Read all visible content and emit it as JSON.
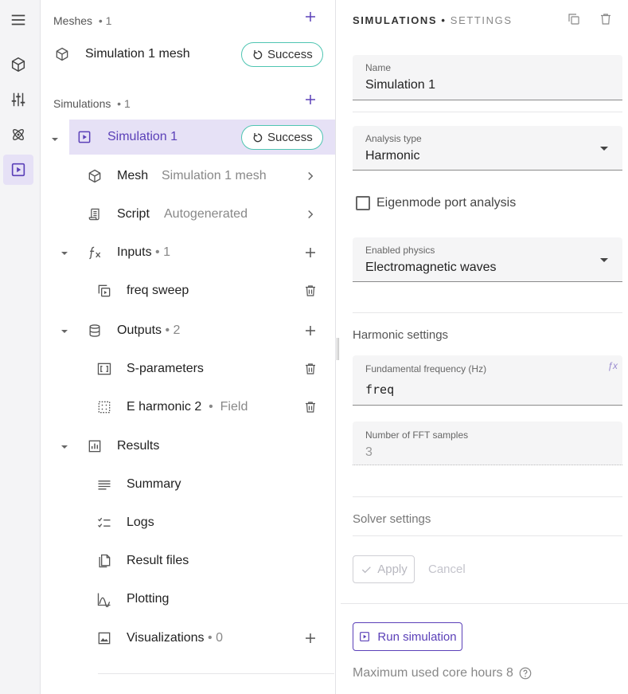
{
  "rail": {
    "items": [
      {
        "icon": "menu-icon"
      },
      {
        "icon": "cube-icon"
      },
      {
        "icon": "sliders-icon"
      },
      {
        "icon": "atom-icon"
      },
      {
        "icon": "play-box-icon",
        "active": true
      }
    ]
  },
  "left": {
    "meshes": {
      "title": "Meshes",
      "sep": "•",
      "count": "1"
    },
    "mesh_item": {
      "label": "Simulation 1 mesh",
      "status": "Success"
    },
    "simulations": {
      "title": "Simulations",
      "sep": "•",
      "count": "1"
    },
    "simulation": {
      "label": "Simulation 1",
      "status": "Success"
    },
    "mesh_row": {
      "label": "Mesh",
      "value": "Simulation 1 mesh"
    },
    "script_row": {
      "label": "Script",
      "value": "Autogenerated"
    },
    "inputs": {
      "label": "Inputs",
      "sep": "•",
      "count": "1"
    },
    "input_item": {
      "label": "freq sweep"
    },
    "outputs": {
      "label": "Outputs",
      "sep": "•",
      "count": "2"
    },
    "output_items": [
      {
        "label": "S-parameters"
      },
      {
        "label": "E harmonic 2",
        "sep": "•",
        "kind": "Field"
      }
    ],
    "results": {
      "label": "Results"
    },
    "result_items": [
      {
        "label": "Summary"
      },
      {
        "label": "Logs"
      },
      {
        "label": "Result files"
      },
      {
        "label": "Plotting"
      }
    ],
    "visualizations": {
      "label": "Visualizations",
      "sep": "•",
      "count": "0"
    }
  },
  "right": {
    "crumb": {
      "first": "SIMULATIONS",
      "sep": "•",
      "second": "SETTINGS"
    },
    "name": {
      "label": "Name",
      "value": "Simulation 1"
    },
    "analysis": {
      "label": "Analysis type",
      "value": "Harmonic"
    },
    "eigenmode": {
      "label": "Eigenmode port analysis",
      "checked": false
    },
    "physics": {
      "label": "Enabled physics",
      "value": "Electromagnetic waves"
    },
    "harmonic_title": "Harmonic settings",
    "freq": {
      "label": "Fundamental frequency (Hz)",
      "value": "freq"
    },
    "fft": {
      "label": "Number of FFT samples",
      "value": "3"
    },
    "solver_title": "Solver settings",
    "apply_label": "Apply",
    "cancel_label": "Cancel",
    "run_label": "Run simulation",
    "core_hours": "Maximum used core hours 8"
  },
  "colors": {
    "accent": "#5b40b8",
    "success": "#4fc5b2",
    "selected_bg": "#e6e1f6"
  }
}
